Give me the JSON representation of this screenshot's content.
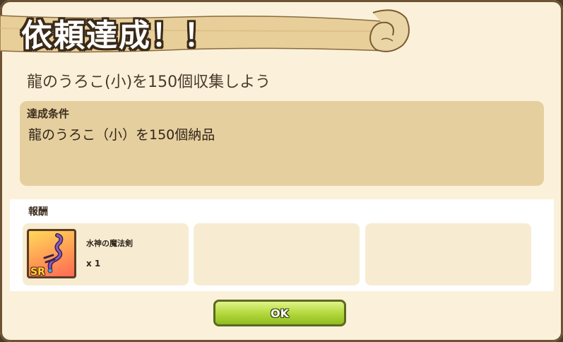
{
  "dialog": {
    "title": "依頼達成！！",
    "quest_name": "龍のうろこ(小)を150個収集しよう"
  },
  "condition": {
    "label": "達成条件",
    "text": "龍のうろこ（小）を150個納品"
  },
  "rewards": {
    "label": "報酬",
    "items": [
      {
        "name": "水神の魔法剣",
        "quantity": "x 1",
        "rarity": "SR",
        "icon": "water-god-magic-sword-icon"
      }
    ]
  },
  "ok_button": {
    "label": "OK"
  },
  "colors": {
    "dialog_bg": "#fbf1da",
    "condition_bg": "#e6cf9f",
    "ok_button_green": "#b5d93e"
  }
}
